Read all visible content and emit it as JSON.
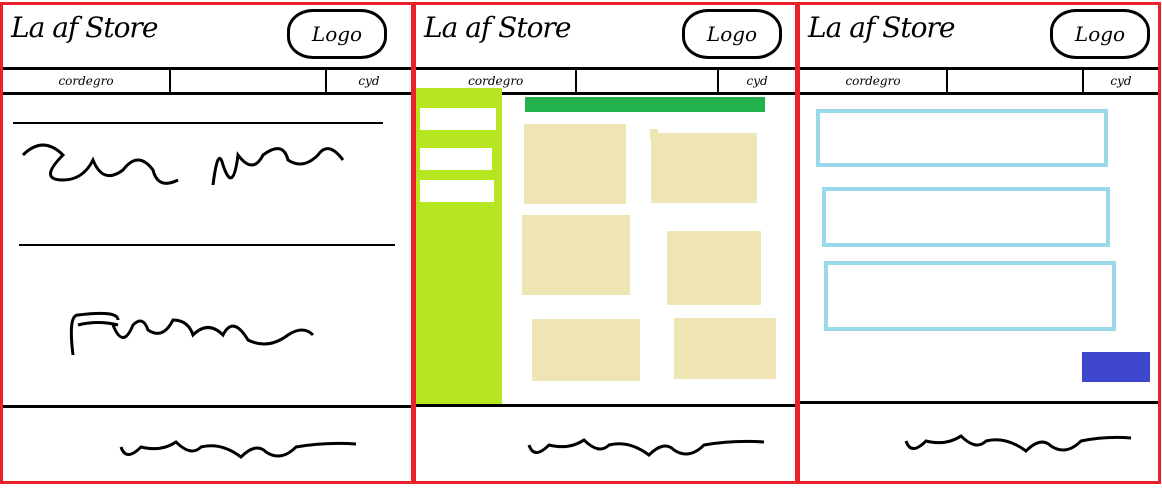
{
  "store_title": "La af Store",
  "logo_label": "Logo",
  "nav": {
    "item1": "cordegro",
    "item2": "",
    "item3": "cyd"
  },
  "colors": {
    "panel_border": "#e8212b",
    "sidebar": "#b5e61f",
    "header_bar": "#22b14b",
    "product_tile": "#efe4b3",
    "form_field_border": "#99d9ea",
    "submit_button": "#3f48cc"
  }
}
